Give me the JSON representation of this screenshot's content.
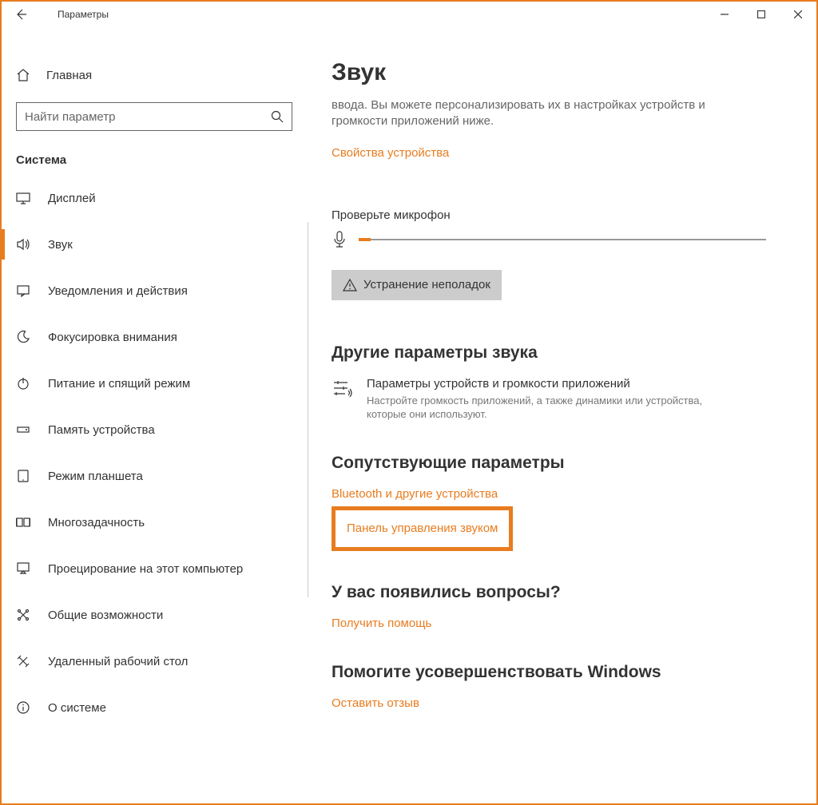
{
  "window": {
    "title": "Параметры"
  },
  "sidebar": {
    "home_label": "Главная",
    "search_placeholder": "Найти параметр",
    "section_header": "Система",
    "items": [
      {
        "label": "Дисплей"
      },
      {
        "label": "Звук",
        "active": true
      },
      {
        "label": "Уведомления и действия"
      },
      {
        "label": "Фокусировка внимания"
      },
      {
        "label": "Питание и спящий режим"
      },
      {
        "label": "Память устройства"
      },
      {
        "label": "Режим планшета"
      },
      {
        "label": "Многозадачность"
      },
      {
        "label": "Проецирование на этот компьютер"
      },
      {
        "label": "Общие возможности"
      },
      {
        "label": "Удаленный рабочий стол"
      },
      {
        "label": "О системе"
      }
    ]
  },
  "main": {
    "page_title": "Звук",
    "desc": "ввода. Вы можете персонализировать их в настройках устройств и громкости приложений ниже.",
    "device_properties_link": "Свойства устройства",
    "mic_check_label": "Проверьте микрофон",
    "troubleshoot_label": "Устранение неполадок",
    "other_params_title": "Другие параметры звука",
    "app_volume": {
      "title": "Параметры устройств и громкости приложений",
      "desc": "Настройте громкость приложений, а также динамики или устройства, которые они используют."
    },
    "related_title": "Сопутствующие параметры",
    "bluetooth_link": "Bluetooth и другие устройства",
    "sound_cp_link": "Панель управления звуком",
    "help_title": "У вас появились вопросы?",
    "get_help_link": "Получить помощь",
    "feedback_title": "Помогите усовершенствовать Windows",
    "feedback_link": "Оставить отзыв"
  },
  "colors": {
    "accent": "#e87c1f"
  }
}
